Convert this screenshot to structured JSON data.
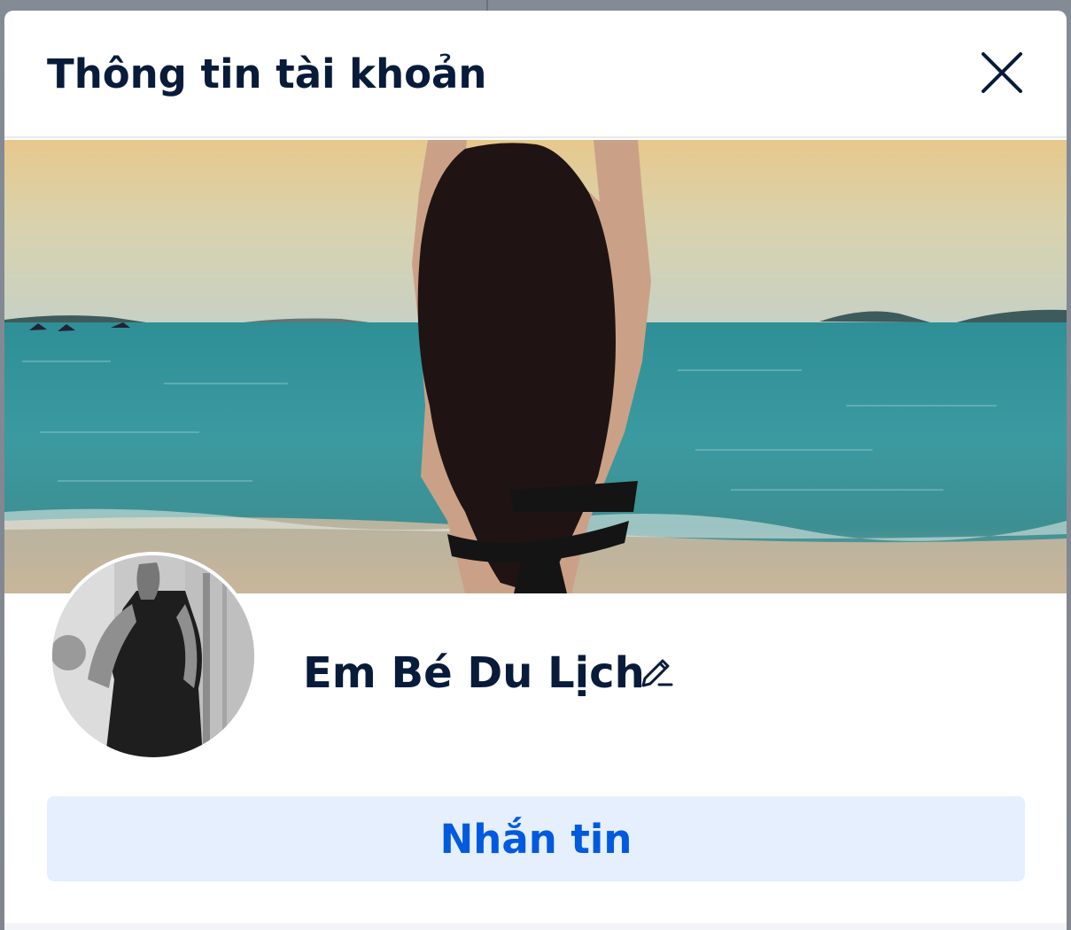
{
  "modal": {
    "title": "Thông tin tài khoản",
    "close_icon": "close-icon"
  },
  "profile": {
    "name": "Em Bé Du Lịch",
    "edit_icon": "pencil-icon",
    "cover_image": "beach-cover-photo",
    "avatar_image": "profile-avatar-photo"
  },
  "actions": {
    "message_label": "Nhắn tin"
  },
  "colors": {
    "title": "#081b3a",
    "button_bg": "#e5effd",
    "button_text": "#005ae0"
  }
}
